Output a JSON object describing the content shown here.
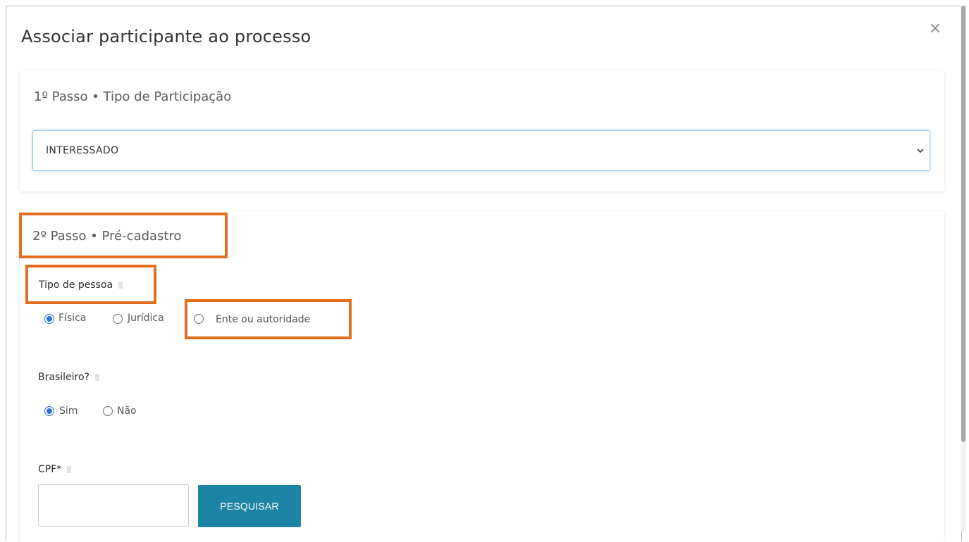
{
  "modal": {
    "title": "Associar participante ao processo",
    "close_icon": "close-icon"
  },
  "step1": {
    "title": "1º Passo • Tipo de Participação",
    "select_value": "INTERESSADO"
  },
  "step2": {
    "title": "2º Passo • Pré-cadastro",
    "tipo_pessoa": {
      "label": "Tipo de pessoa",
      "options": [
        "Física",
        "Jurídica",
        "Ente ou autoridade"
      ],
      "selected": "Física"
    },
    "brasileiro": {
      "label": "Brasileiro?",
      "options": [
        "Sim",
        "Não"
      ],
      "selected": "Sim"
    },
    "cpf": {
      "label": "CPF*",
      "value": "",
      "button_label": "PESQUISAR"
    }
  },
  "colors": {
    "highlight": "#e07020",
    "button": "#1d84a5",
    "radio_checked": "#2f73d8"
  }
}
